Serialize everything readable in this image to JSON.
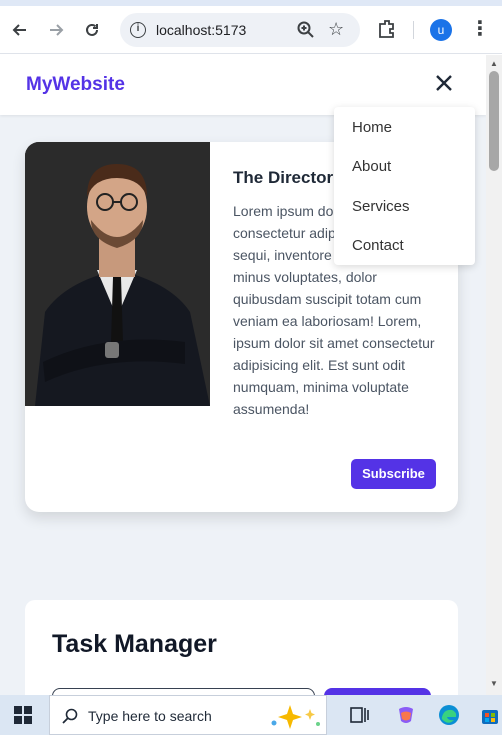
{
  "browser": {
    "url": "localhost:5173",
    "avatar_letter": "u"
  },
  "site": {
    "brand": "MyWebsite",
    "menu": [
      "Home",
      "About",
      "Services",
      "Contact"
    ]
  },
  "profile_card": {
    "title": "The Director",
    "body": "Lorem ipsum dolor sit amet consectetur adipisicing elit. Velit sequi, inventore praesentium minus voluptates, dolor quibusdam suscipit totam cum veniam ea laboriosam! Lorem, ipsum dolor sit amet consectetur adipisicing elit. Est sunt odit numquam, minima voluptate assumenda!",
    "button": "Subscribe"
  },
  "task_manager": {
    "title": "Task Manager"
  },
  "taskbar": {
    "search_placeholder": "Type here to search"
  },
  "colors": {
    "accent": "#5433e6",
    "page_bg": "#eef2f7"
  }
}
